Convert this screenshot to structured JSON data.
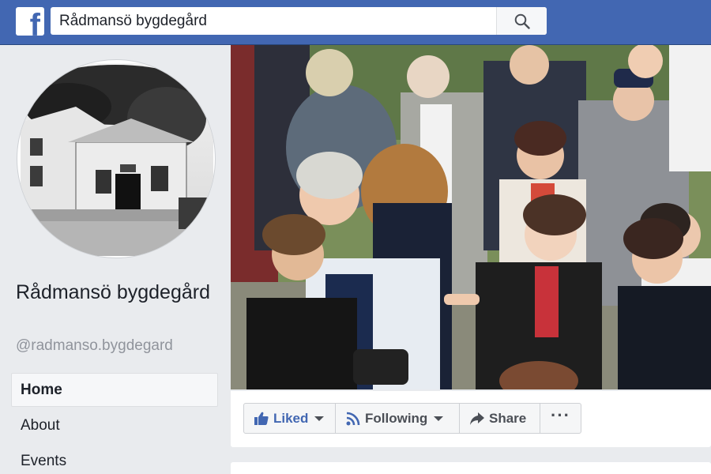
{
  "header": {
    "logo_icon": "facebook-f-icon",
    "search_value": "Rådmansö bygdegård",
    "search_icon": "search-icon"
  },
  "page": {
    "name": "Rådmansö bygdegård",
    "handle": "@radmanso.bygdegard"
  },
  "sidebar": {
    "items": [
      {
        "label": "Home",
        "active": true
      },
      {
        "label": "About",
        "active": false
      },
      {
        "label": "Events",
        "active": false
      }
    ]
  },
  "actions": {
    "liked": {
      "label": "Liked",
      "icon": "thumbs-up-icon"
    },
    "following": {
      "label": "Following",
      "icon": "rss-feed-icon"
    },
    "share": {
      "label": "Share",
      "icon": "share-arrow-icon"
    },
    "more": {
      "label": "···",
      "icon": "more-dots-icon"
    }
  },
  "colors": {
    "brand_blue": "#4267b2",
    "page_bg": "#e9ebee",
    "muted_text": "#90949c"
  }
}
